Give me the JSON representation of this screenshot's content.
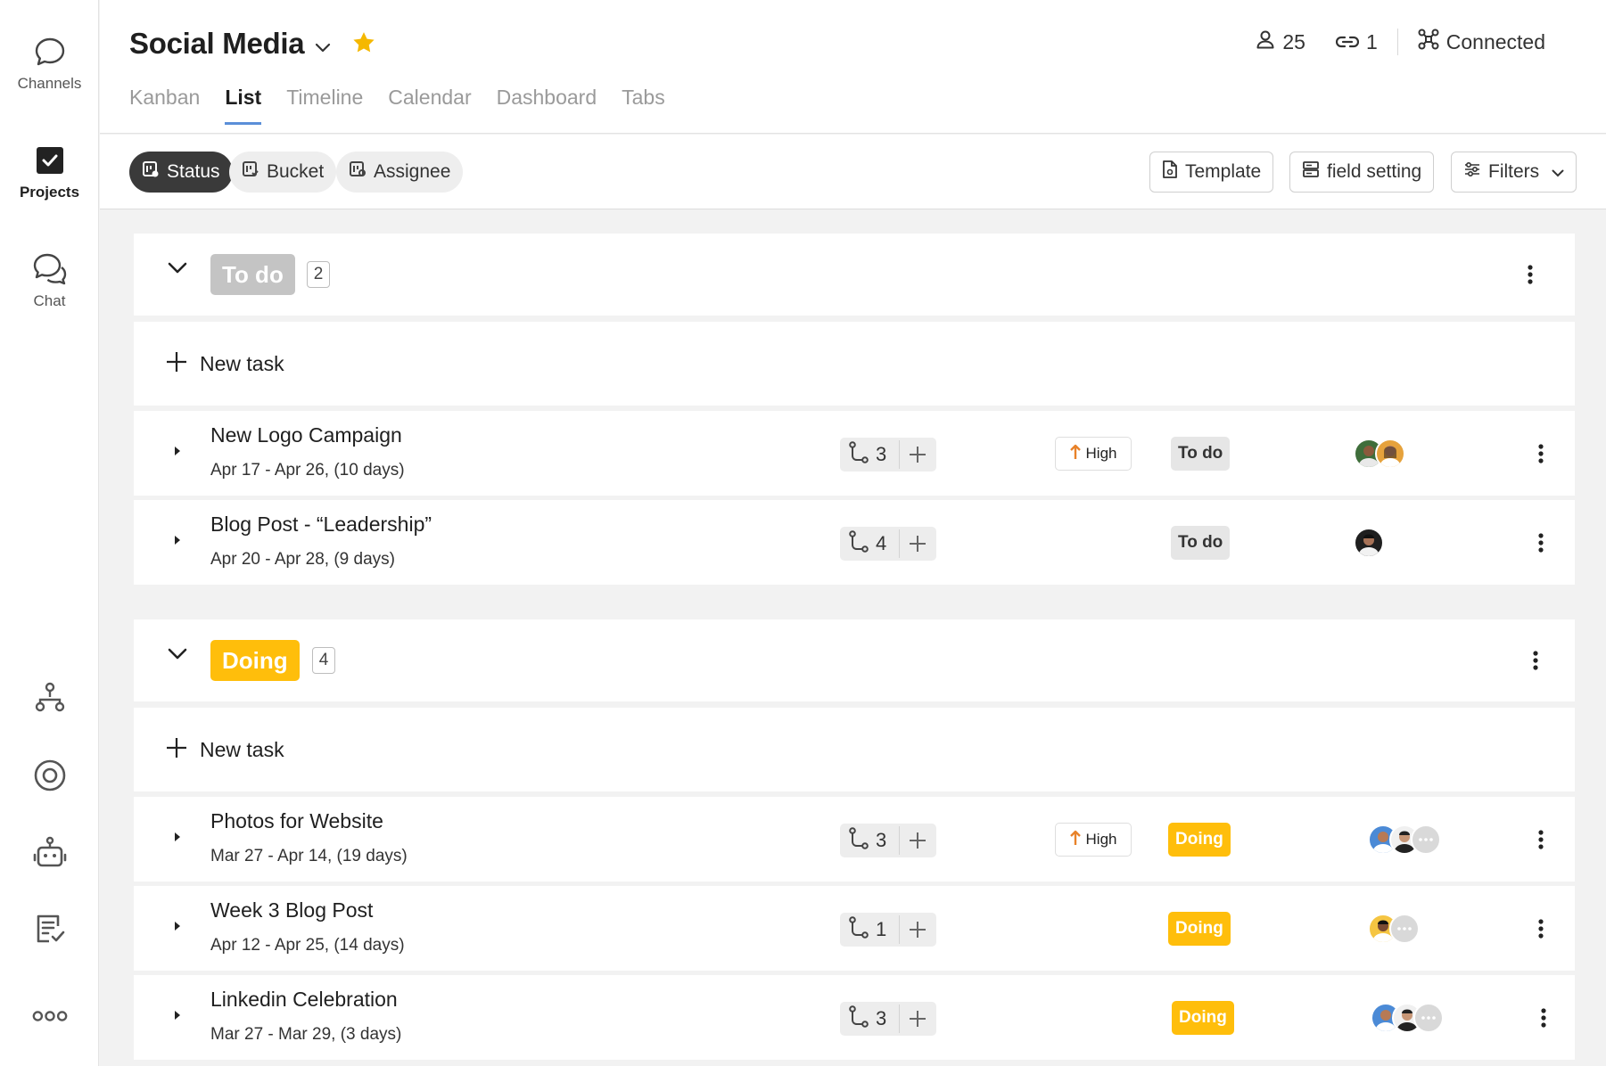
{
  "sidebar": {
    "items": [
      {
        "label": "Channels",
        "icon": "chat-bubble-icon"
      },
      {
        "label": "Projects",
        "icon": "checkbox-icon"
      },
      {
        "label": "Chat",
        "icon": "chat-double-icon"
      }
    ],
    "bottom_icons": [
      "org-chart-icon",
      "target-icon",
      "robot-icon",
      "checklist-icon",
      "more-icon"
    ]
  },
  "header": {
    "title": "Social Media",
    "members_count": "25",
    "links_count": "1",
    "connection_status": "Connected",
    "star_color": "#f5b800"
  },
  "tabs": [
    "Kanban",
    "List",
    "Timeline",
    "Calendar",
    "Dashboard",
    "Tabs"
  ],
  "active_tab": "List",
  "toolbar": {
    "group_chips": [
      "Status",
      "Bucket",
      "Assignee"
    ],
    "active_chip": "Status",
    "template_label": "Template",
    "field_setting_label": "field setting",
    "filters_label": "Filters"
  },
  "groups": [
    {
      "name": "To do",
      "count": "2",
      "color": "#c4c4c4",
      "new_task_label": "New task",
      "tasks": [
        {
          "name": "New Logo Campaign",
          "dates": "Apr 17 - Apr 26, (10 days)",
          "subtasks": "3",
          "priority": "High",
          "status": "To do"
        },
        {
          "name": "Blog Post - “Leadership”",
          "dates": "Apr 20 - Apr 28, (9 days)",
          "subtasks": "4",
          "priority": "",
          "status": "To do"
        }
      ]
    },
    {
      "name": "Doing",
      "count": "4",
      "color": "#ffbe0b",
      "new_task_label": "New task",
      "tasks": [
        {
          "name": "Photos for Website",
          "dates": "Mar 27 - Apr 14, (19 days)",
          "subtasks": "3",
          "priority": "High",
          "status": "Doing"
        },
        {
          "name": "Week 3 Blog Post",
          "dates": "Apr 12 - Apr 25, (14 days)",
          "subtasks": "1",
          "priority": "",
          "status": "Doing"
        },
        {
          "name": "Linkedin Celebration",
          "dates": "Mar 27 - Mar 29, (3 days)",
          "subtasks": "3",
          "priority": "",
          "status": "Doing"
        }
      ]
    }
  ]
}
